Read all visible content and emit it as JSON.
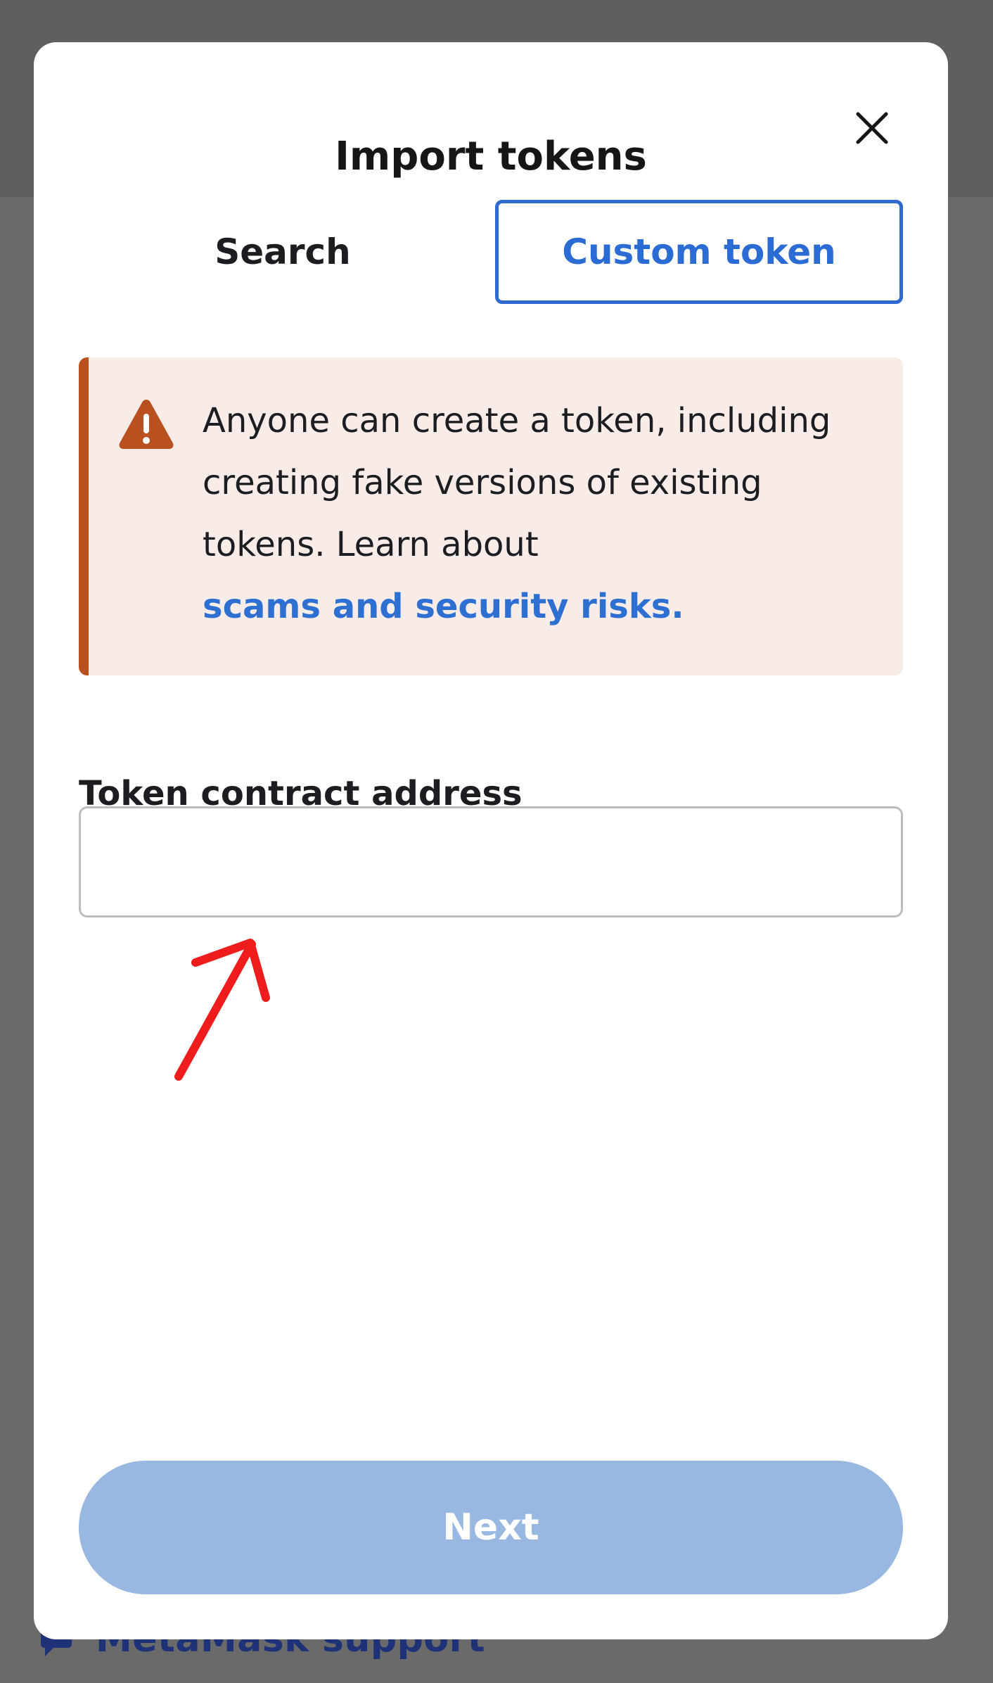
{
  "modal": {
    "title": "Import tokens",
    "close_icon": "close-icon"
  },
  "tabs": [
    {
      "label": "Search",
      "active": false
    },
    {
      "label": "Custom token",
      "active": true
    }
  ],
  "alert": {
    "icon": "warning-icon",
    "text": "Anyone can create a token, including creating fake versions of existing tokens. Learn about ",
    "link_text": "scams and security risks."
  },
  "address_field": {
    "label": "Token contract address",
    "value": "",
    "placeholder": ""
  },
  "next_button": {
    "label": "Next",
    "enabled": false
  },
  "background": {
    "support_link": "MetaMask support"
  },
  "colors": {
    "accent": "#2f6ad0",
    "warning": "#b8511f",
    "alert_bg": "#f7ece8",
    "next_disabled": "#99b8e1",
    "annotation": "#ee1c1c"
  }
}
